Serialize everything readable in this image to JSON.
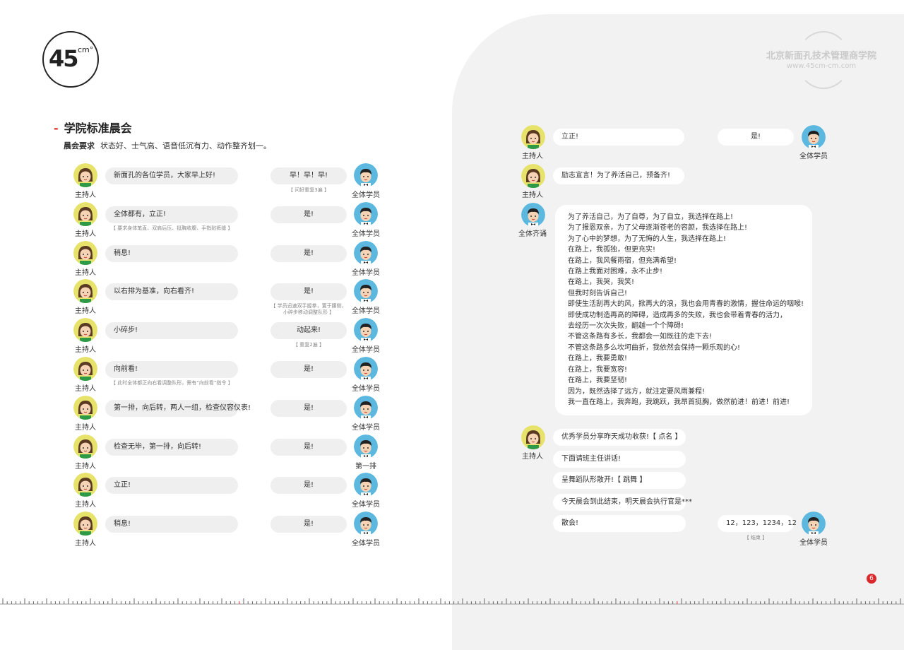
{
  "logo": {
    "num": "45",
    "sup": "cm°"
  },
  "seal": {
    "name": "北京新面孔技术管理商学院",
    "url": "www.45cm-cm.com"
  },
  "section": {
    "dash": "-",
    "title": "学院标准晨会",
    "req_label": "晨会要求",
    "req_text": "状态好、士气高、语音低沉有力、动作整齐划一。"
  },
  "left_rows": [
    {
      "host_role": "主持人",
      "host_text": "新面孔的各位学员，大家早上好!",
      "host_note": "",
      "resp_text": "早！早！早!",
      "resp_note": "【 问好重复3遍 】",
      "resp_role": "全体学员"
    },
    {
      "host_role": "主持人",
      "host_text": "全体都有，立正!",
      "host_note": "【 要求身体笔直、双肩后压、挺胸收腹、手指贴裤缝 】",
      "resp_text": "是!",
      "resp_note": "",
      "resp_role": "全体学员"
    },
    {
      "host_role": "主持人",
      "host_text": "稍息!",
      "host_note": "",
      "resp_text": "是!",
      "resp_note": "",
      "resp_role": "全体学员"
    },
    {
      "host_role": "主持人",
      "host_text": "以右排为基准，向右看齐!",
      "host_note": "",
      "resp_text": "是!",
      "resp_note": "【 学员迅速双手握拳，置于腰侧，小碎步移动调整队形 】",
      "resp_role": "全体学员"
    },
    {
      "host_role": "主持人",
      "host_text": "小碎步!",
      "host_note": "",
      "resp_text": "动起来!",
      "resp_note": "【 重复2遍 】",
      "resp_role": "全体学员"
    },
    {
      "host_role": "主持人",
      "host_text": "向前看!",
      "host_note": "【 此时全体都正向右看调整队形，需有“向前看”指令 】",
      "resp_text": "是!",
      "resp_note": "",
      "resp_role": "全体学员"
    },
    {
      "host_role": "主持人",
      "host_text": "第一排，向后转，两人一组，检查仪容仪表!",
      "host_note": "",
      "resp_text": "是!",
      "resp_note": "",
      "resp_role": "全体学员"
    },
    {
      "host_role": "主持人",
      "host_text": "检查无毕，第一排，向后转!",
      "host_note": "",
      "resp_text": "是!",
      "resp_note": "",
      "resp_role": "第一排"
    },
    {
      "host_role": "主持人",
      "host_text": "立正!",
      "host_note": "",
      "resp_text": "是!",
      "resp_note": "",
      "resp_role": "全体学员"
    },
    {
      "host_role": "主持人",
      "host_text": "稍息!",
      "host_note": "",
      "resp_text": "是!",
      "resp_note": "",
      "resp_role": "全体学员"
    }
  ],
  "right": {
    "row1": {
      "host_role": "主持人",
      "host_text": "立正!",
      "resp_text": "是!",
      "resp_role": "全体学员"
    },
    "row2": {
      "host_role": "主持人",
      "host_text": "励志宣言！为了养活自己，预备齐!"
    },
    "recite_role": "全体齐诵",
    "recite_lines": [
      "为了养活自己，为了自尊，为了自立，我选择在路上!",
      "为了报恩双亲，为了父母逐渐苍老的容颜，我选择在路上!",
      "为了心中的梦想，为了无悔的人生，我选择在路上!",
      "在路上，我孤独，但更充实!",
      "在路上，我风餐雨宿，但充满希望!",
      "在路上我面对困难，永不止步!",
      "在路上，我哭，我笑!",
      "但我时刻告诉自己!",
      "即使生活刮再大的风，掀再大的浪，我也会用青春的激情，握住命运的咽喉!",
      "即使成功制造再高的障碍，造成再多的失败，我也会带着青春的活力，",
      "去经历一次次失败，翻越一个个障碍!",
      "不管这条路有多长，我都会一如既往的走下去!",
      "不管这条路多么坎坷曲折，我依然会保持一颗乐观的心!",
      "在路上，我要勇敢!",
      "在路上，我要宽容!",
      "在路上，我要坚韧!",
      "因为，既然选择了远方，就注定要风雨兼程!",
      "我一直在路上，我奔跑，我跳跃，我昂首挺胸，做然前进！前进！前进!"
    ],
    "closing_role": "主持人",
    "closing": [
      "优秀学员分享昨天成功收获!【 点名 】",
      "下面请班主任讲话!",
      "呈舞蹈队形散开!【 跳舞 】",
      "今天晨会到此结束，明天晨会执行官是***",
      "散会!"
    ],
    "end_text": "12，123，1234，12",
    "end_note": "【 结束 】",
    "end_role": "全体学员"
  },
  "page_number": "6",
  "colors": {
    "accent": "#e0322e",
    "host_avatar_bg": "#e6e26a",
    "student_avatar_bg": "#5cb8de",
    "panel": "#f2f2f2"
  }
}
